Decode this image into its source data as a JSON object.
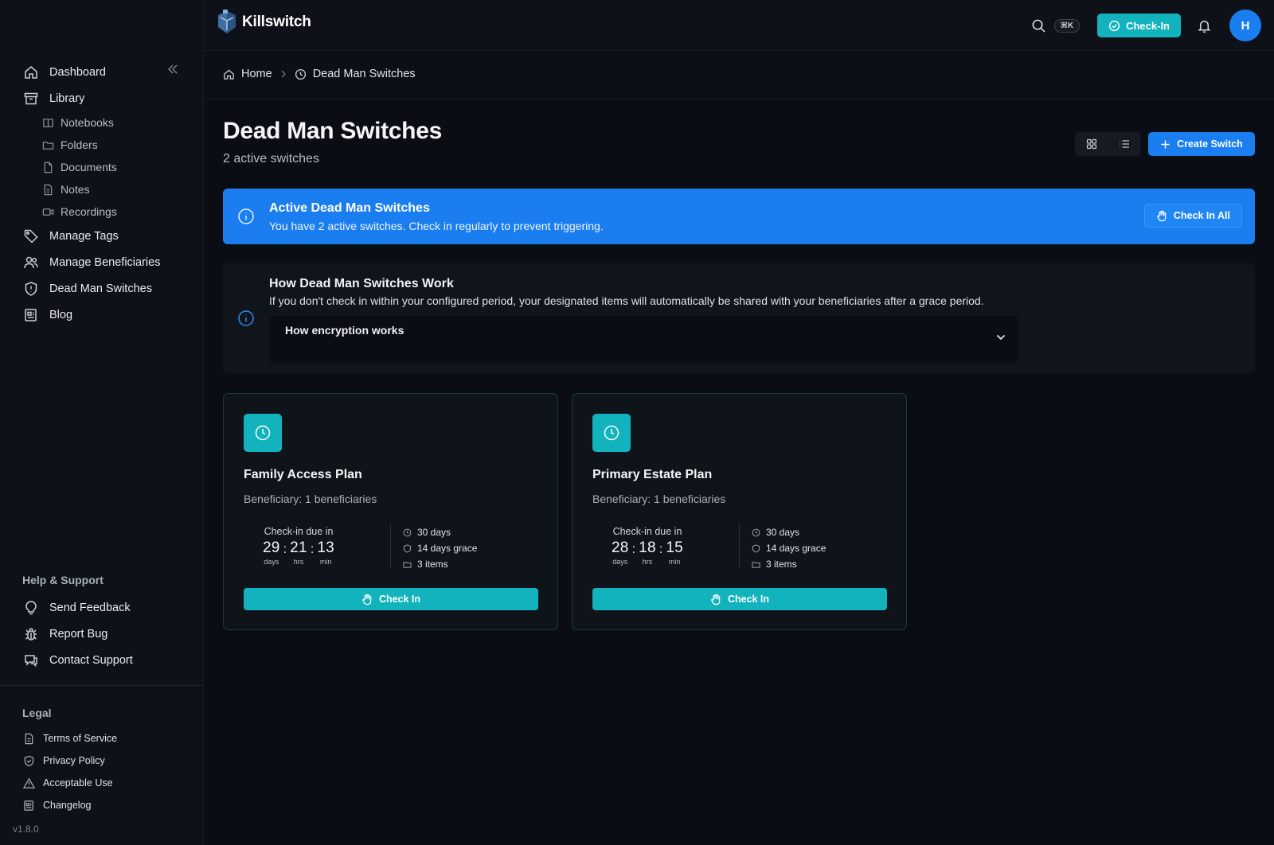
{
  "app": {
    "name": "Killswitch",
    "version": "v1.8.0"
  },
  "topbar": {
    "shortcut": "⌘K",
    "checkin_label": "Check-In",
    "avatar_initial": "H"
  },
  "sidebar": {
    "nav": [
      {
        "label": "Dashboard",
        "icon": "home-icon"
      },
      {
        "label": "Library",
        "icon": "archive-icon"
      }
    ],
    "library_items": [
      {
        "label": "Notebooks",
        "icon": "book-icon"
      },
      {
        "label": "Folders",
        "icon": "folder-icon"
      },
      {
        "label": "Documents",
        "icon": "document-icon"
      },
      {
        "label": "Notes",
        "icon": "note-icon"
      },
      {
        "label": "Recordings",
        "icon": "video-icon"
      }
    ],
    "nav_more": [
      {
        "label": "Manage Tags",
        "icon": "tag-icon"
      },
      {
        "label": "Manage Beneficiaries",
        "icon": "users-icon"
      },
      {
        "label": "Dead Man Switches",
        "icon": "shield-icon"
      },
      {
        "label": "Blog",
        "icon": "newspaper-icon"
      }
    ],
    "help_title": "Help & Support",
    "help": [
      {
        "label": "Send Feedback",
        "icon": "lightbulb-icon"
      },
      {
        "label": "Report Bug",
        "icon": "bug-icon"
      },
      {
        "label": "Contact Support",
        "icon": "chat-icon"
      }
    ],
    "legal_title": "Legal",
    "legal": [
      {
        "label": "Terms of Service",
        "icon": "document-icon"
      },
      {
        "label": "Privacy Policy",
        "icon": "shield-icon"
      },
      {
        "label": "Acceptable Use",
        "icon": "warning-icon"
      },
      {
        "label": "Changelog",
        "icon": "newspaper-icon"
      }
    ]
  },
  "breadcrumb": {
    "home": "Home",
    "current": "Dead Man Switches"
  },
  "main": {
    "title": "Dead Man Switches",
    "subtitle": "2 active switches",
    "create_label": "Create Switch"
  },
  "alert": {
    "title": "Active Dead Man Switches",
    "text": "You have 2 active switches. Check in regularly to prevent triggering.",
    "button": "Check In All"
  },
  "howto": {
    "title": "How Dead Man Switches Work",
    "text": "If you don't check in within your configured period, your designated items will automatically be shared with your beneficiaries after a grace period.",
    "accordion": "How encryption works"
  },
  "cards": [
    {
      "title": "Family Access Plan",
      "beneficiary": "Beneficiary: 1 beneficiaries",
      "due_label": "Check-in due in",
      "days": "29",
      "hrs": "21",
      "min": "13",
      "days_label": "days",
      "hrs_label": "hrs",
      "min_label": "min",
      "period": "30 days",
      "grace": "14 days grace",
      "items": "3 items",
      "button": "Check In"
    },
    {
      "title": "Primary Estate Plan",
      "beneficiary": "Beneficiary: 1 beneficiaries",
      "due_label": "Check-in due in",
      "days": "28",
      "hrs": "18",
      "min": "15",
      "days_label": "days",
      "hrs_label": "hrs",
      "min_label": "min",
      "period": "30 days",
      "grace": "14 days grace",
      "items": "3 items",
      "button": "Check In"
    }
  ],
  "colors": {
    "accent_teal": "#12b3bd",
    "accent_blue": "#1a7ef0",
    "background": "#0a0e14"
  }
}
